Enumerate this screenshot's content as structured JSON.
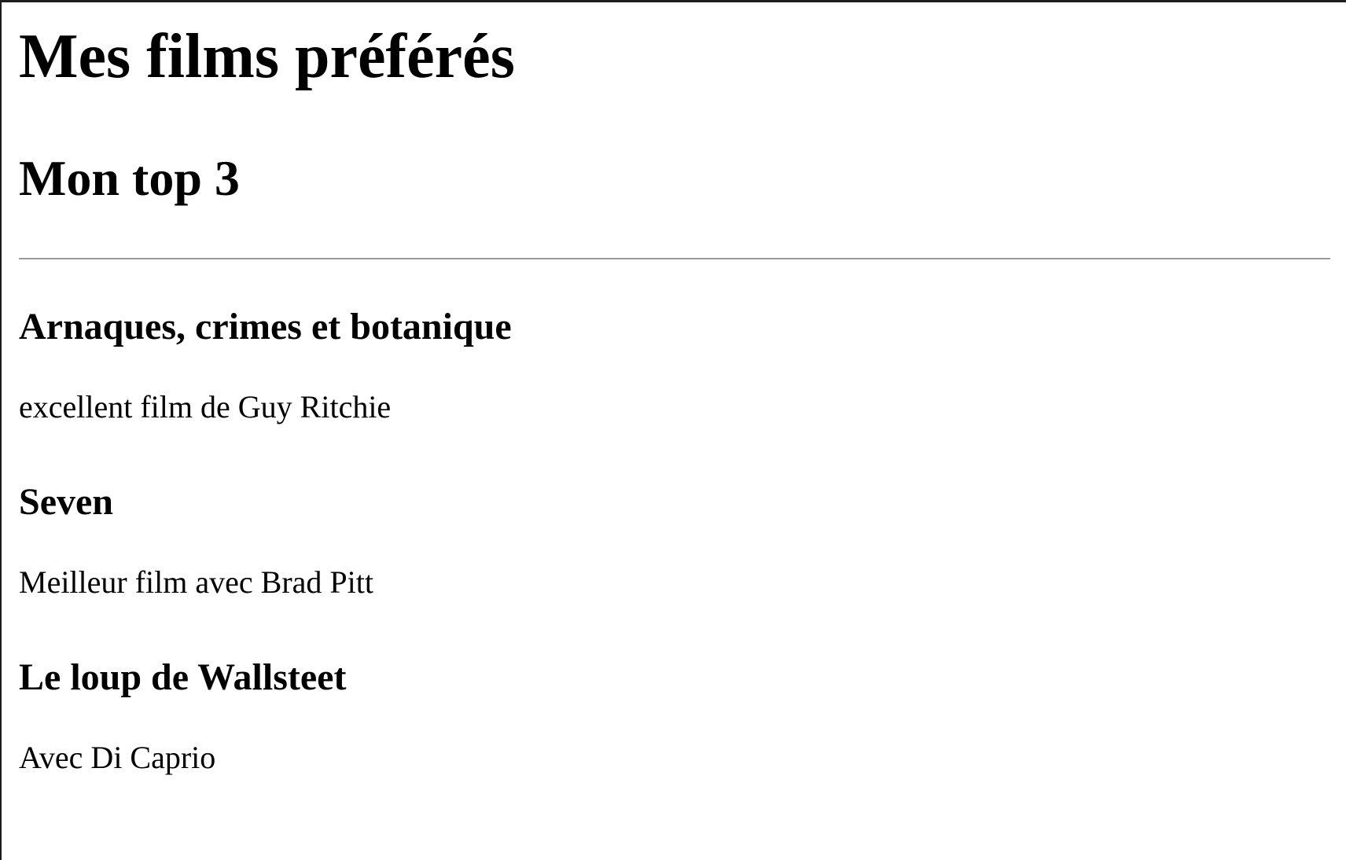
{
  "page": {
    "title": "Mes films préférés",
    "subtitle": "Mon top 3"
  },
  "movies": [
    {
      "title": "Arnaques, crimes et botanique",
      "description": "excellent film de Guy Ritchie"
    },
    {
      "title": "Seven",
      "description": "Meilleur film avec Brad Pitt"
    },
    {
      "title": "Le loup de Wallsteet",
      "description": "Avec Di Caprio"
    }
  ]
}
